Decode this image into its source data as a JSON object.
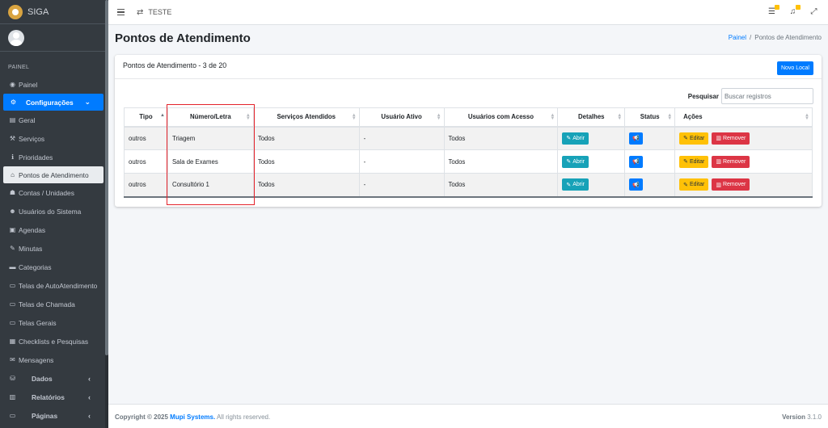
{
  "app": {
    "name": "SIGA"
  },
  "sidebar": {
    "header": "PAINEL",
    "items": [
      {
        "label": "Painel",
        "icon": "gauge-icon",
        "glyph": "◉"
      },
      {
        "label": "Configurações",
        "icon": "cogs-icon",
        "glyph": "⚙"
      },
      {
        "label": "Geral",
        "icon": "printer-icon",
        "glyph": "▤"
      },
      {
        "label": "Serviços",
        "icon": "wrench-icon",
        "glyph": "🔧"
      },
      {
        "label": "Prioridades",
        "icon": "info-icon",
        "glyph": "ℹ"
      },
      {
        "label": "Pontos de Atendimento",
        "icon": "home-icon",
        "glyph": "⌂"
      },
      {
        "label": "Contas / Unidades",
        "icon": "sitemap-icon",
        "glyph": "☗"
      },
      {
        "label": "Usuários do Sistema",
        "icon": "users-icon",
        "glyph": "☻"
      },
      {
        "label": "Agendas",
        "icon": "address-book-icon",
        "glyph": "▣"
      },
      {
        "label": "Minutas",
        "icon": "edit-icon",
        "glyph": "✎"
      },
      {
        "label": "Categorias",
        "icon": "folder-icon",
        "glyph": "▬"
      },
      {
        "label": "Telas de AutoAtendimento",
        "icon": "desktop-icon",
        "glyph": "▭"
      },
      {
        "label": "Telas de Chamada",
        "icon": "desktop-icon",
        "glyph": "▭"
      },
      {
        "label": "Telas Gerais",
        "icon": "desktop-icon",
        "glyph": "▭"
      },
      {
        "label": "Checklists e Pesquisas",
        "icon": "list-alt-icon",
        "glyph": "▦"
      },
      {
        "label": "Mensagens",
        "icon": "envelope-icon",
        "glyph": "✉"
      },
      {
        "label": "Dados",
        "icon": "database-icon",
        "glyph": "⛁"
      },
      {
        "label": "Relatórios",
        "icon": "chart-icon",
        "glyph": "▥"
      },
      {
        "label": "Páginas",
        "icon": "desktop-icon",
        "glyph": "▭"
      }
    ]
  },
  "navbar": {
    "title": "TESTE"
  },
  "page": {
    "title": "Pontos de Atendimento",
    "breadcrumb": {
      "home": "Painel",
      "separator": "/",
      "current": "Pontos de Atendimento"
    }
  },
  "card": {
    "title": "Pontos de Atendimento - 3 de 20",
    "new_button": "Novo Local",
    "search_label": "Pesquisar",
    "search_placeholder": "Buscar registros"
  },
  "table": {
    "columns": [
      "Tipo",
      "Número/Letra",
      "Serviços Atendidos",
      "Usuário Ativo",
      "Usuários com Acesso",
      "Detalhes",
      "Status",
      "Ações"
    ],
    "rows": [
      {
        "tipo": "outros",
        "numero": "Triagem",
        "servicos": "Todos",
        "usuario": "-",
        "acesso": "Todos"
      },
      {
        "tipo": "outros",
        "numero": "Sala de Exames",
        "servicos": "Todos",
        "usuario": "-",
        "acesso": "Todos"
      },
      {
        "tipo": "outros",
        "numero": "Consultório 1",
        "servicos": "Todos",
        "usuario": "-",
        "acesso": "Todos"
      }
    ],
    "actions": {
      "details": "Abrir",
      "edit": "Editar",
      "remove": "Remover"
    }
  },
  "footer": {
    "copyright": "Copyright © 2025",
    "company": "Mupi Systems.",
    "rights": "All rights reserved.",
    "version_label": "Version",
    "version": "3.1.0"
  },
  "colors": {
    "primary": "#007bff",
    "info": "#17a2b8",
    "warning": "#ffc107",
    "danger": "#dc3545",
    "sidebar": "#343a40",
    "highlight": "#e4232b"
  }
}
